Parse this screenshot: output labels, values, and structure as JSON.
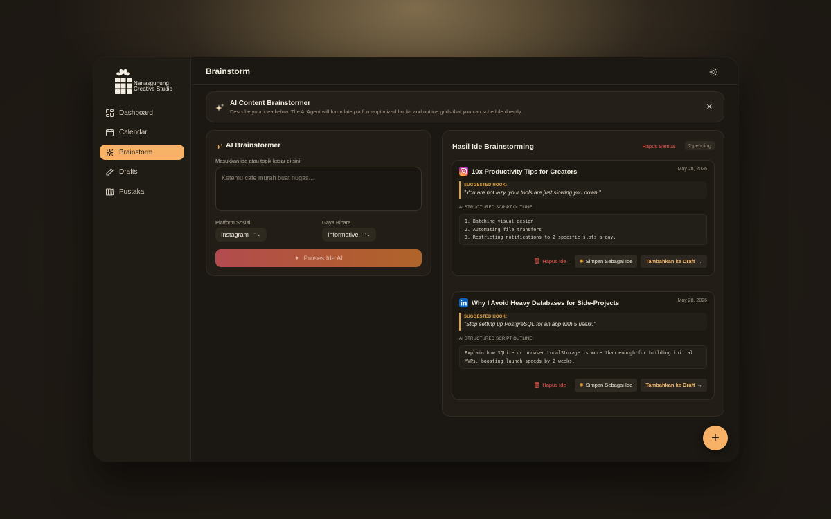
{
  "brand": {
    "line1": "Nanasgunung",
    "line2": "Creative Studio"
  },
  "sidebar": {
    "items": [
      {
        "label": "Dashboard",
        "icon": "dashboard-icon",
        "active": false
      },
      {
        "label": "Calendar",
        "icon": "calendar-icon",
        "active": false
      },
      {
        "label": "Brainstorm",
        "icon": "sparkle-icon",
        "active": true
      },
      {
        "label": "Drafts",
        "icon": "pencil-icon",
        "active": false
      },
      {
        "label": "Pustaka",
        "icon": "library-icon",
        "active": false
      }
    ]
  },
  "header": {
    "title": "Brainstorm",
    "theme_icon": "sun-icon"
  },
  "banner": {
    "title": "AI Content Brainstormer",
    "description": "Describe your idea below. The AI Agent will formulate platform-optimized hooks and outline grids that you can schedule directly."
  },
  "form": {
    "title": "AI Brainstormer",
    "input_label": "Masukkan ide atau topik kasar di sini",
    "input_placeholder": "Ketemu cafe murah buat nugas...",
    "platform_label": "Platform Sosial",
    "platform_value": "Instagram",
    "style_label": "Gaya Bicara",
    "style_value": "Informative",
    "submit_label": "Proses Ide AI"
  },
  "results": {
    "title": "Hasil Ide Brainstorming",
    "clear_all": "Hapus Semua",
    "pending": "2 pending",
    "hook_label": "SUGGESTED HOOK:",
    "outline_label": "AI STRUCTURED SCRIPT OUTLINE:",
    "delete_label": "Hapus Ide",
    "save_label": "Simpan Sebagai Ide",
    "draft_label": "Tambahkan ke Draft",
    "ideas": [
      {
        "platform": "instagram",
        "title": "10x Productivity Tips for Creators",
        "date": "May 28, 2026",
        "hook": "\"You are not lazy, your tools are just slowing you down.\"",
        "outline": [
          "1. Batching visual design",
          "2. Automating file transfers",
          "3. Restricting notifications to 2 specific slots a day."
        ]
      },
      {
        "platform": "linkedin",
        "title": "Why I Avoid Heavy Databases for Side-Projects",
        "date": "May 28, 2026",
        "hook": "\"Stop setting up PostgreSQL for an app with 5 users.\"",
        "outline": [
          "Explain how SQLite or browser LocalStorage is more than enough for building initial",
          "MVPs, boosting launch speeds by 2 weeks."
        ]
      }
    ]
  },
  "fab": {
    "label": "+"
  },
  "colors": {
    "accent": "#f7b267",
    "danger": "#ef5b50",
    "hook": "#e9a53f"
  }
}
